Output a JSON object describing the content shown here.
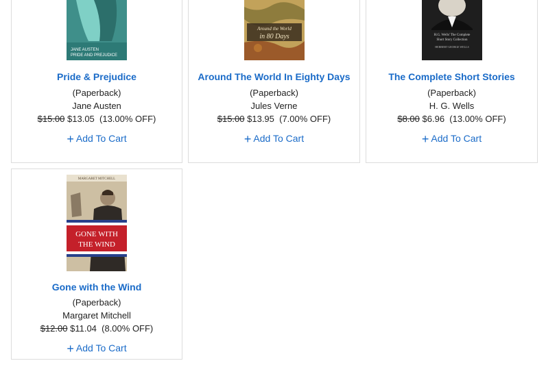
{
  "books": [
    {
      "title": "Pride & Prejudice",
      "format": "(Paperback)",
      "author": "Jane Austen",
      "old_price": "$15.00",
      "price": "$13.05",
      "discount": "(13.00% OFF)",
      "cart_label": "Add To Cart",
      "cover_text": [
        "JANE AUSTEN",
        "PRIDE AND PREJUDICE"
      ]
    },
    {
      "title": "Around The World In Eighty Days",
      "format": "(Paperback)",
      "author": "Jules Verne",
      "old_price": "$15.00",
      "price": "$13.95",
      "discount": "(7.00% OFF)",
      "cart_label": "Add To Cart",
      "cover_text": [
        "Around the World",
        "in 80 Days"
      ]
    },
    {
      "title": "The Complete Short Stories",
      "format": "(Paperback)",
      "author": "H. G. Wells",
      "old_price": "$8.00",
      "price": "$6.96",
      "discount": "(13.00% OFF)",
      "cart_label": "Add To Cart",
      "cover_text": [
        "H.G. Wells' The Complete",
        "Short Story Collection",
        "HERBERT GEORGE WELLS"
      ]
    },
    {
      "title": "Gone with the Wind",
      "format": "(Paperback)",
      "author": "Margaret Mitchell",
      "old_price": "$12.00",
      "price": "$11.04",
      "discount": "(8.00% OFF)",
      "cart_label": "Add To Cart",
      "cover_text": [
        "MARGARET MITCHELL",
        "GONE WITH",
        "THE WIND"
      ]
    }
  ],
  "colors": {
    "link": "#1a6bc8",
    "border": "#dcdcdc"
  },
  "icons": {
    "cart": "plus-icon"
  }
}
